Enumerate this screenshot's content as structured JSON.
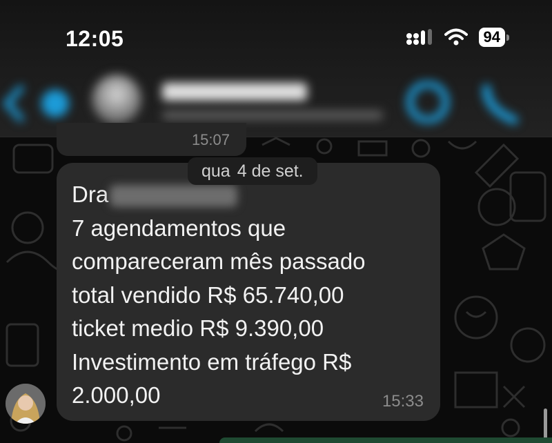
{
  "status_bar": {
    "time": "12:05",
    "battery": "94",
    "icons": [
      "signal-icon",
      "wifi-icon",
      "battery-icon"
    ]
  },
  "chat_header": {
    "icons": [
      "back-icon",
      "video-call-icon",
      "phone-call-icon"
    ]
  },
  "previous_message": {
    "time": "15:07"
  },
  "date_chip": {
    "prefix": "qua",
    "label": "4 de set."
  },
  "message": {
    "greeting": "Dra",
    "lines": [
      "7 agendamentos que",
      "compareceram mês passado",
      "total vendido R$ 65.740,00",
      "ticket medio R$ 9.390,00",
      "Investimento em tráfego R$",
      "2.000,00"
    ],
    "time": "15:33"
  },
  "colors": {
    "bubble": "#2b2b2b",
    "background": "#0b0b0b",
    "accent": "#1c9bd8"
  }
}
